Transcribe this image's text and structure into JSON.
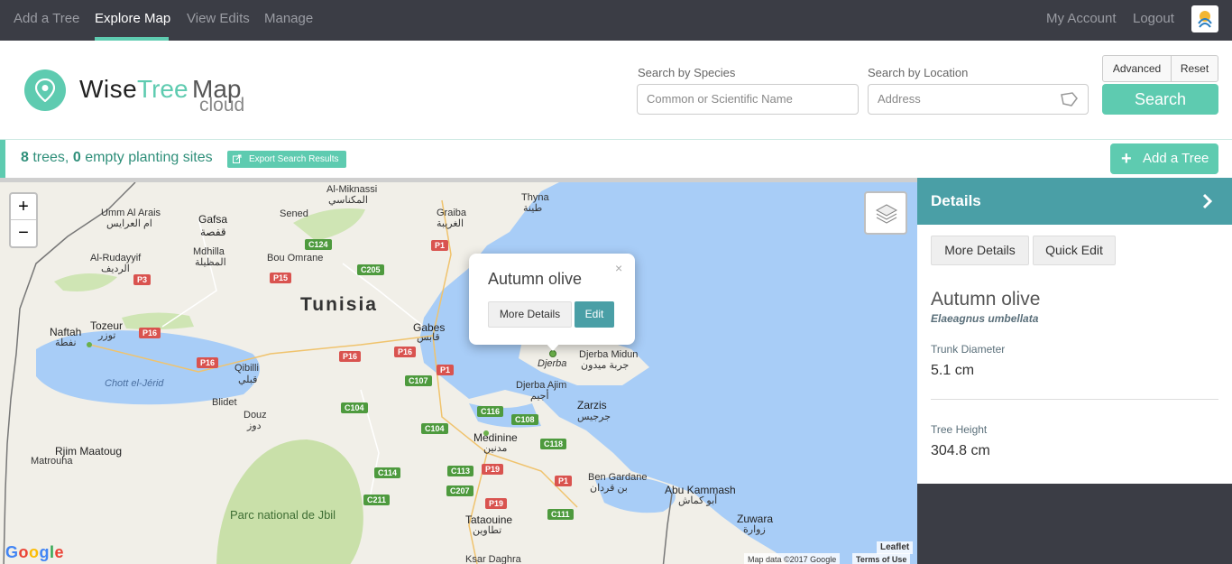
{
  "nav": {
    "items": [
      "Add a Tree",
      "Explore Map",
      "View Edits",
      "Manage"
    ],
    "account": "My Account",
    "logout": "Logout"
  },
  "brand": {
    "wise": "Wise",
    "tree": "Tree",
    "map": "Map",
    "cloud": "cloud"
  },
  "search": {
    "species_label": "Search by Species",
    "species_placeholder": "Common or Scientific Name",
    "location_label": "Search by Location",
    "location_placeholder": "Address",
    "advanced": "Advanced",
    "reset": "Reset",
    "submit": "Search"
  },
  "results": {
    "tree_count": "8",
    "trees_label": "trees,",
    "empty_count": "0",
    "empty_label": "empty planting sites",
    "export": "Export Search Results",
    "add_tree": "Add a Tree"
  },
  "map": {
    "zoom_in": "+",
    "zoom_out": "−",
    "country": "Tunisia",
    "cities": [
      "Umm Al Arais",
      "ام العرايس",
      "Gafsa",
      "قفصة",
      "Sened",
      "Al-Miknassi",
      "المكناسي",
      "Graiba",
      "الغريبة",
      "Thyna",
      "طينة",
      "Mdhilla",
      "المظيلة",
      "Bou Omrane",
      "Al-Rudayyif",
      "الرديف",
      "Tozeur",
      "توزر",
      "Naftah",
      "نفطة",
      "Gabes",
      "قابس",
      "Qibilli",
      "قبلي",
      "Blidet",
      "Douz",
      "دوز",
      "Djerba Midun",
      "جربة ميدون",
      "Djerba",
      "Djerba Ajim",
      "أجيم",
      "Zarzis",
      "جرجيس",
      "Medinine",
      "مدنين",
      "Rjim Maatoug",
      "Matrouha",
      "Ben Gardane",
      "بن قردان",
      "Abu Kammash",
      "أبو كماش",
      "Zuwara",
      "زوارة",
      "Tataouine",
      "تطاوين",
      "Ksar Daghra"
    ],
    "water": [
      "Chott el-Jérid"
    ],
    "park": "Parc national de Jbil",
    "roads": [
      "P1",
      "C124",
      "C205",
      "P15",
      "P3",
      "P16",
      "P16",
      "P16",
      "P16",
      "P1",
      "C107",
      "C104",
      "C104",
      "C116",
      "C108",
      "C118",
      "C114",
      "C113",
      "P19",
      "C207",
      "P19",
      "P1",
      "C211",
      "C111"
    ],
    "attribution": "Map data ©2017 Google",
    "terms": "Terms of Use",
    "leaflet": "Leaflet",
    "google": "Google"
  },
  "popup": {
    "title": "Autumn olive",
    "close": "×",
    "more_details": "More Details",
    "edit": "Edit"
  },
  "details": {
    "title": "Details",
    "more_details": "More Details",
    "quick_edit": "Quick Edit",
    "common_name": "Autumn olive",
    "scientific_name": "Elaeagnus umbellata",
    "trunk_label": "Trunk Diameter",
    "trunk_value": "5.1 cm",
    "height_label": "Tree Height",
    "height_value": "304.8 cm"
  },
  "colors": {
    "accent": "#5ecbb0",
    "teal_dark": "#4a9fa6",
    "nav_bg": "#3b3d45"
  }
}
